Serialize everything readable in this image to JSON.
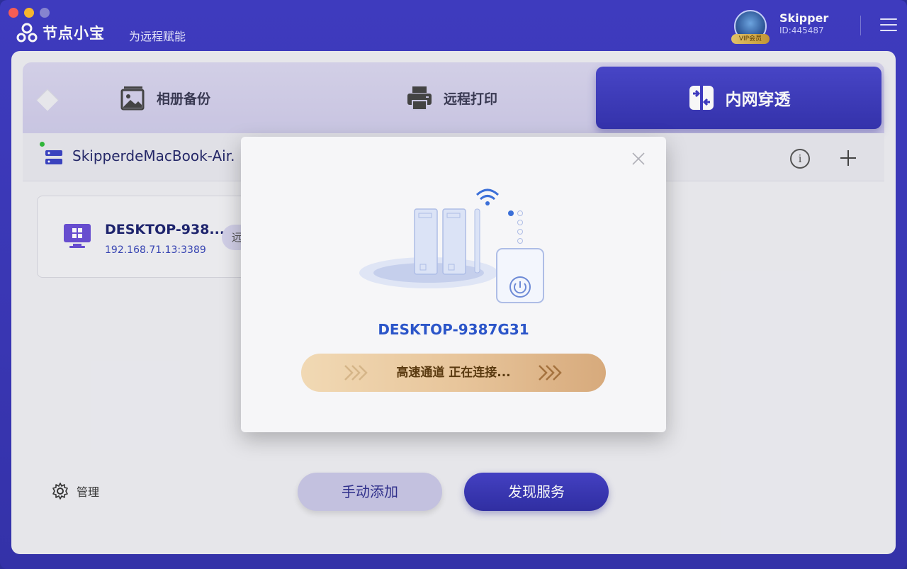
{
  "app": {
    "name": "节点小宝",
    "slogan": "为远程赋能"
  },
  "user": {
    "name": "Skipper",
    "id": "ID:445487",
    "badge": "VIP会员"
  },
  "tabs": [
    {
      "label": "相册备份",
      "icon": "photo-album-icon"
    },
    {
      "label": "远程打印",
      "icon": "printer-icon"
    },
    {
      "label": "内网穿透",
      "icon": "tunnel-icon",
      "active": true
    }
  ],
  "device": {
    "name": "SkipperdeMacBook-Air.",
    "online": true
  },
  "card": {
    "title": "DESKTOP-938...",
    "address": "192.168.71.13:3389",
    "action": "远"
  },
  "footer": {
    "manage_label": "管理",
    "manual_add_label": "手动添加",
    "discover_label": "发现服务"
  },
  "modal": {
    "device_name": "DESKTOP-9387G31",
    "status": "高速通道 正在连接..."
  },
  "colors": {
    "accent": "#3f3cc4",
    "online": "#2fbb3a",
    "connect_gold": "#e8c69c"
  }
}
